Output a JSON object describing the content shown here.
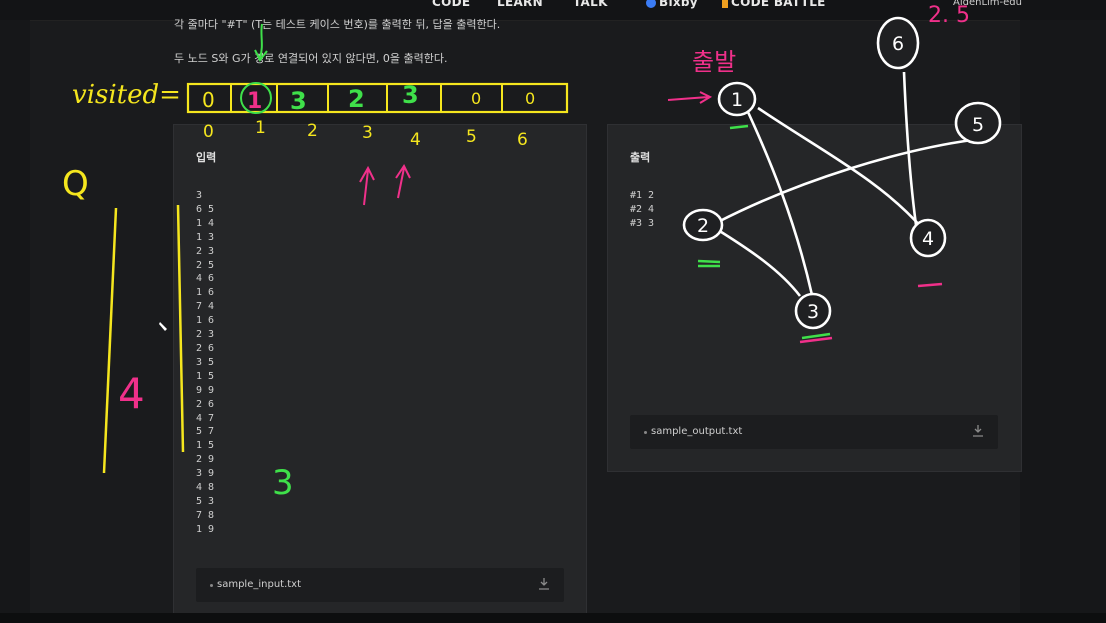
{
  "nav": {
    "code": "CODE",
    "learn": "LEARN",
    "talk": "TALK",
    "bixby": "Bixby",
    "code_battle": "CODE BATTLE",
    "user": "AidenLim-edu"
  },
  "description": {
    "line1": "각 줄마다 \"#T\" (T는 테스트 케이스 번호)를 출력한 뒤, 답을 출력한다.",
    "line2": "두 노드 S와 G가 경로 연결되어 있지 않다면, 0을 출력한다."
  },
  "input_panel": {
    "title": "입력",
    "lines": [
      "3",
      "6 5",
      "1 4",
      "1 3",
      "2 3",
      "2 5",
      "4 6",
      "1 6",
      "7 4",
      "1 6",
      "2 3",
      "2 6",
      "3 5",
      "1 5",
      "9 9",
      "2 6",
      "4 7",
      "5 7",
      "1 5",
      "2 9",
      "3 9",
      "4 8",
      "5 3",
      "7 8",
      "1 9"
    ],
    "file": "sample_input.txt"
  },
  "output_panel": {
    "title": "출력",
    "lines": [
      "#1 2",
      "#2 4",
      "#3 3"
    ],
    "file": "sample_output.txt"
  },
  "annotations": {
    "visited_label": "visited=",
    "visited_cells": [
      "0",
      "1",
      "3",
      "2",
      "3",
      "0",
      "0"
    ],
    "indices": [
      "0",
      "1",
      "2",
      "3",
      "4",
      "5",
      "6"
    ],
    "queue_label": "Q",
    "queue_count": "4",
    "green_three": "3",
    "start_label": "출발",
    "graph_nodes": [
      "1",
      "2",
      "3",
      "4",
      "5",
      "6"
    ],
    "top_scribble": "2. 5",
    "colors": {
      "yellow": "#f5e61e",
      "green": "#3fe04a",
      "pink": "#f0308a",
      "white": "#ffffff"
    }
  }
}
